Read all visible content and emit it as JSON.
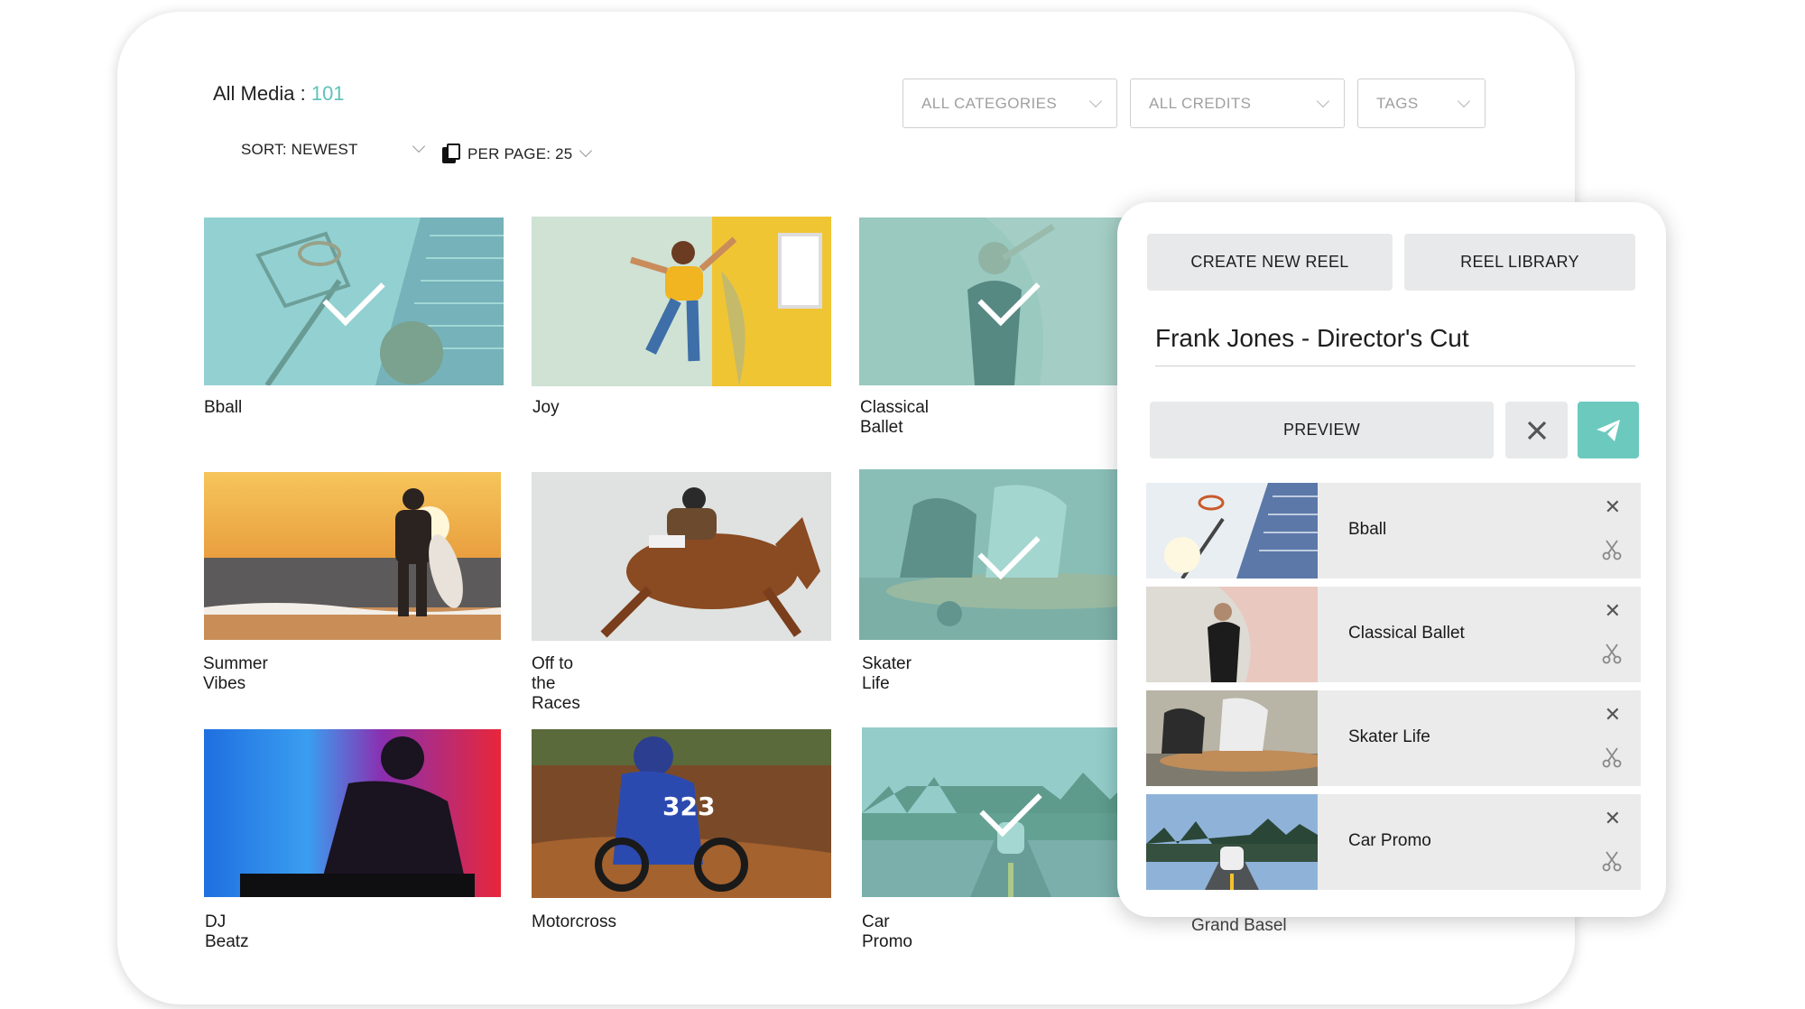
{
  "header": {
    "all_media_label": "All Media : ",
    "all_media_count": "101",
    "sort_label": "SORT: NEWEST",
    "per_page_label": "PER PAGE: 25",
    "filters": [
      "ALL CATEGORIES",
      "ALL CREDITS",
      "TAGS"
    ]
  },
  "grid": {
    "items": [
      {
        "title": "Bball",
        "selected": true
      },
      {
        "title": "Joy",
        "selected": false
      },
      {
        "title": "Classical Ballet",
        "selected": true
      },
      {
        "title": "Summer Vibes",
        "selected": false
      },
      {
        "title": "Off to the Races",
        "selected": false
      },
      {
        "title": "Skater Life",
        "selected": true
      },
      {
        "title": "DJ Beatz",
        "selected": false
      },
      {
        "title": "Motorcross",
        "selected": false
      },
      {
        "title": "Car Promo",
        "selected": true
      },
      {
        "title": "Grand Basel",
        "selected": false
      }
    ]
  },
  "reel": {
    "create_new_label": "CREATE NEW REEL",
    "library_label": "REEL LIBRARY",
    "title": "Frank Jones - Director's Cut",
    "preview_label": "PREVIEW",
    "clips": [
      {
        "title": "Bball"
      },
      {
        "title": "Classical Ballet"
      },
      {
        "title": "Skater Life"
      },
      {
        "title": "Car Promo"
      }
    ]
  },
  "colors": {
    "accent": "#5cc3b8",
    "selected_overlay": "#7dcdc4",
    "panel_button": "#e8e9ea"
  },
  "icons": [
    "copy-icon",
    "chevron-down-icon",
    "check-icon",
    "close-icon",
    "send-icon",
    "scissors-icon"
  ]
}
